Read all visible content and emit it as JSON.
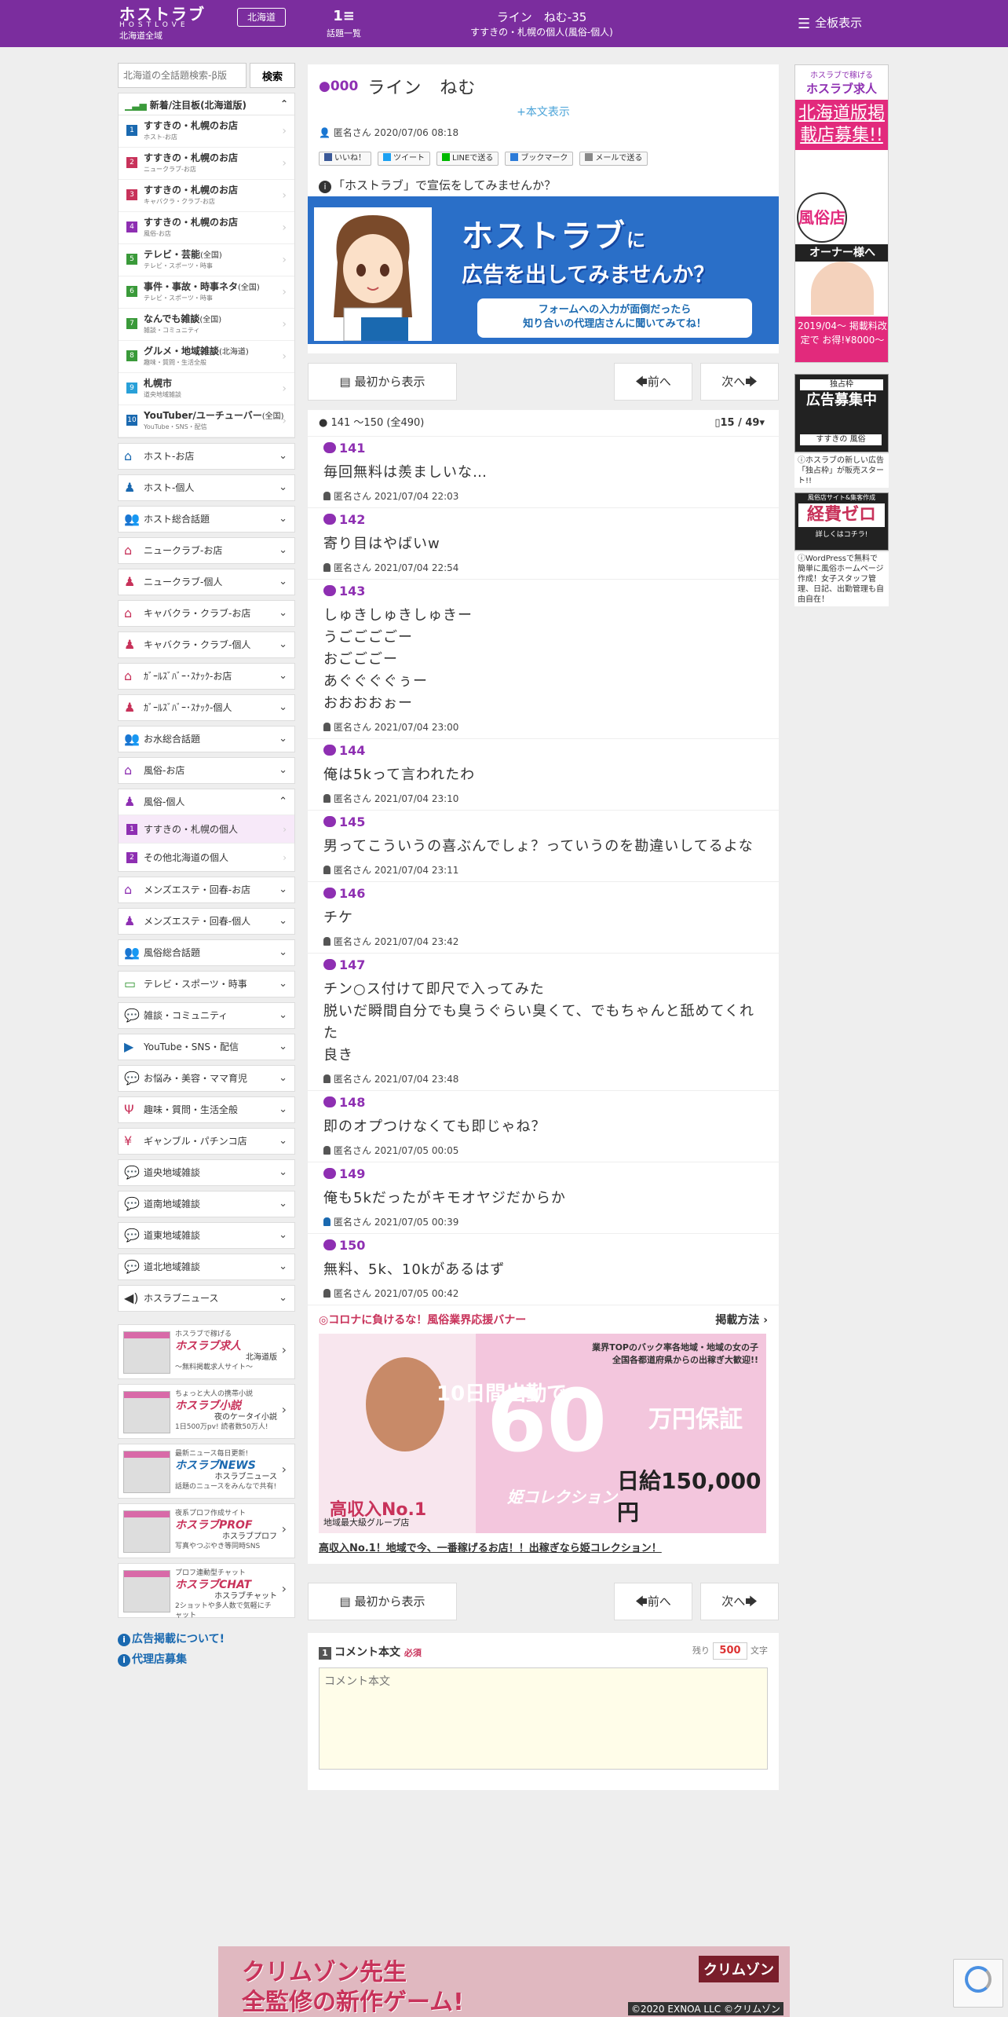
{
  "header": {
    "logo_main": "ホストラブ",
    "logo_sub": "HOSTLOVE",
    "logo_region": "北海道全域",
    "region_button": "北海道",
    "topics_label": "話題一覧",
    "title": "ライン　ねむ-35",
    "subtitle": "すすきの・札幌の個人(風俗-個人)",
    "show_all": "全板表示"
  },
  "sidebar": {
    "search_placeholder": "北海道の全話題検索-β版",
    "search_button": "検索",
    "new_header": "新着/注目板(北海道版)",
    "ranking": [
      {
        "n": "1",
        "label": "すすきの・札幌のお店",
        "pref": "",
        "sub": "ホスト-お店",
        "color": "#1a69b0"
      },
      {
        "n": "2",
        "label": "すすきの・札幌のお店",
        "pref": "",
        "sub": "ニュークラブ-お店",
        "color": "#c8325a"
      },
      {
        "n": "3",
        "label": "すすきの・札幌のお店",
        "pref": "",
        "sub": "キャバクラ・クラブ-お店",
        "color": "#c8325a"
      },
      {
        "n": "4",
        "label": "すすきの・札幌のお店",
        "pref": "",
        "sub": "風俗-お店",
        "color": "#8e2fb2"
      },
      {
        "n": "5",
        "label": "テレビ・芸能",
        "pref": "(全国)",
        "sub": "テレビ・スポーツ・時事",
        "color": "#3a9a3a"
      },
      {
        "n": "6",
        "label": "事件・事故・時事ネタ",
        "pref": "(全国)",
        "sub": "テレビ・スポーツ・時事",
        "color": "#3a9a3a"
      },
      {
        "n": "7",
        "label": "なんでも雑談",
        "pref": "(全国)",
        "sub": "雑談・コミュニティ",
        "color": "#3a9a3a"
      },
      {
        "n": "8",
        "label": "グルメ・地域雑談",
        "pref": "(北海道)",
        "sub": "趣味・質問・生活全般",
        "color": "#3a9a3a"
      },
      {
        "n": "9",
        "label": "札幌市",
        "pref": "",
        "sub": "道央地域雑談",
        "color": "#29a0d8"
      },
      {
        "n": "10",
        "label": "YouTuber/ユーチューバー",
        "pref": "(全国)",
        "sub": "YouTube・SNS・配信",
        "color": "#1a69b0"
      }
    ],
    "categories_top": [
      {
        "label": "ホスト-お店",
        "icon": "house-icon",
        "cls": ""
      },
      {
        "label": "ホスト-個人",
        "icon": "person-icon",
        "cls": ""
      },
      {
        "label": "ホスト総合話題",
        "icon": "group-icon",
        "cls": ""
      },
      {
        "label": "ニュークラブ-お店",
        "icon": "house-icon",
        "cls": "red"
      },
      {
        "label": "ニュークラブ-個人",
        "icon": "person-icon",
        "cls": "red"
      },
      {
        "label": "キャバクラ・クラブ-お店",
        "icon": "house-icon",
        "cls": "pink"
      },
      {
        "label": "キャバクラ・クラブ-個人",
        "icon": "person-icon",
        "cls": "pink"
      },
      {
        "label": "ｶﾞｰﾙｽﾞﾊﾞｰ･ｽﾅｯｸ-お店",
        "icon": "house-icon",
        "cls": "pink"
      },
      {
        "label": "ｶﾞｰﾙｽﾞﾊﾞｰ･ｽﾅｯｸ-個人",
        "icon": "person-icon",
        "cls": "pink"
      },
      {
        "label": "お水総合話題",
        "icon": "group-icon",
        "cls": "pink"
      },
      {
        "label": "風俗-お店",
        "icon": "house-icon",
        "cls": "pur"
      }
    ],
    "open_category": {
      "label": "風俗-個人",
      "items": [
        {
          "n": "1",
          "label": "すすきの・札幌の個人"
        },
        {
          "n": "2",
          "label": "その他北海道の個人"
        }
      ]
    },
    "categories_bottom": [
      {
        "label": "メンズエステ・回春-お店",
        "icon": "house-icon",
        "cls": "pur"
      },
      {
        "label": "メンズエステ・回春-個人",
        "icon": "person-icon",
        "cls": "pur"
      },
      {
        "label": "風俗総合話題",
        "icon": "group-icon",
        "cls": "pur"
      },
      {
        "label": "テレビ・スポーツ・時事",
        "icon": "tv-icon",
        "cls": "grn"
      },
      {
        "label": "雑談・コミュニティ",
        "icon": "chat-icon",
        "cls": "grn"
      },
      {
        "label": "YouTube・SNS・配信",
        "icon": "youtube-icon",
        "cls": ""
      },
      {
        "label": "お悩み・美容・ママ育児",
        "icon": "chat-icon",
        "cls": ""
      },
      {
        "label": "趣味・質問・生活全般",
        "icon": "fork-icon",
        "cls": "red"
      },
      {
        "label": "ギャンブル・パチンコ店",
        "icon": "money-icon",
        "cls": "red"
      },
      {
        "label": "道央地域雑談",
        "icon": "chat-icon",
        "cls": ""
      },
      {
        "label": "道南地域雑談",
        "icon": "chat-icon",
        "cls": ""
      },
      {
        "label": "道東地域雑談",
        "icon": "chat-icon",
        "cls": ""
      },
      {
        "label": "道北地域雑談",
        "icon": "chat-icon",
        "cls": ""
      },
      {
        "label": "ホスラブニュース",
        "icon": "speaker-icon",
        "cls": "dk"
      }
    ],
    "services": [
      {
        "brand": "ホスラブ求人",
        "top": "ホスラブで稼げる",
        "name": "北海道版",
        "desc": "〜無料掲載求人サイト〜",
        "blue": false
      },
      {
        "brand": "ホスラブ小説",
        "top": "ちょっと大人の携帯小説",
        "name": "夜のケータイ小説",
        "desc": "1日500万pv! 読者数50万人!",
        "blue": false
      },
      {
        "brand": "ホスラブNEWS",
        "top": "最新ニュース毎日更新!",
        "name": "ホスラブニュース",
        "desc": "話題のニュースをみんなで共有!",
        "blue": true
      },
      {
        "brand": "ホスラブPROF",
        "top": "夜系プロフ作成サイト",
        "name": "ホスラブプロフ",
        "desc": "写真やつぶやき等同時SNS",
        "blue": false
      },
      {
        "brand": "ホスラブCHAT",
        "top": "プロフ連動型チャット",
        "name": "ホスラブチャット",
        "desc": "2ショットや多人数で気軽にチャット",
        "blue": false
      }
    ],
    "link_ads": "広告掲載について!",
    "link_agency": "代理店募集"
  },
  "thread": {
    "number": "000",
    "title": "ライン　ねむ",
    "body_toggle": "+本文表示",
    "author": "匿名さん",
    "date": "2020/07/06 08:18",
    "shares": [
      "いいね！",
      "ツイート",
      "LINEで送る",
      "ブックマーク",
      "メールで送る"
    ]
  },
  "ad": {
    "caption": "「ホストラブ」で宣伝をしてみませんか？",
    "headline1": "ホストラブ",
    "headline1_suffix": "に",
    "headline2": "広告を出してみませんか？",
    "box_line1": "フォームへの入力が面倒だったら",
    "box_line2": "知り合いの代理店さんに聞いてみてね！"
  },
  "nav": {
    "first": "最初から表示",
    "prev": "前へ",
    "next": "次へ"
  },
  "list": {
    "range": "141 ～150",
    "total": "(全490)",
    "page": "15 / 49"
  },
  "posts": [
    {
      "no": "141",
      "body": [
        "毎回無料は羨ましいな…"
      ],
      "author": "匿名さん",
      "date": "2021/07/04 22:03",
      "male": false
    },
    {
      "no": "142",
      "body": [
        "寄り目はやばいw"
      ],
      "author": "匿名さん",
      "date": "2021/07/04 22:54",
      "male": false
    },
    {
      "no": "143",
      "body": [
        "しゅきしゅきしゅきー",
        "うごごごごー",
        "おごごごー",
        "あぐぐぐぐぅー",
        "おおおおぉー"
      ],
      "author": "匿名さん",
      "date": "2021/07/04 23:00",
      "male": false
    },
    {
      "no": "144",
      "body": [
        "俺は5kって言われたわ"
      ],
      "author": "匿名さん",
      "date": "2021/07/04 23:10",
      "male": false
    },
    {
      "no": "145",
      "body": [
        "男ってこういうの喜ぶんでしょ？っていうのを勘違いしてるよな"
      ],
      "author": "匿名さん",
      "date": "2021/07/04 23:11",
      "male": false
    },
    {
      "no": "146",
      "body": [
        "チケ"
      ],
      "author": "匿名さん",
      "date": "2021/07/04 23:42",
      "male": false
    },
    {
      "no": "147",
      "body": [
        "チン○ス付けて即尺で入ってみた",
        "脱いだ瞬間自分でも臭うぐらい臭くて、でもちゃんと舐めてくれた",
        "良き"
      ],
      "author": "匿名さん",
      "date": "2021/07/04 23:48",
      "male": false
    },
    {
      "no": "148",
      "body": [
        "即のオプつけなくても即じゃね？"
      ],
      "author": "匿名さん",
      "date": "2021/07/05 00:05",
      "male": false
    },
    {
      "no": "149",
      "body": [
        "俺も5kだったがキモオヤジだからか"
      ],
      "author": "匿名さん",
      "date": "2021/07/05 00:39",
      "male": true
    },
    {
      "no": "150",
      "body": [
        "無料、5k、10kがあるはず"
      ],
      "author": "匿名さん",
      "date": "2021/07/05 00:42",
      "male": false
    }
  ],
  "banner": {
    "header": "◎コロナに負けるな！風俗業界応援バナー",
    "method": "掲載方法",
    "copy1": "業界TOPのバック率各地域・地域の女の子",
    "copy2": "全国各都道府県からの出稼ぎ大歓迎!!",
    "days": "10日間出勤で",
    "big": "60",
    "guarantee": "万円保証",
    "daily": "日給150,000円",
    "brand": "姫コレクション",
    "income": "高収入No.1",
    "group": "地域最大級グループ店",
    "link": "高収入No.1！地域で今、一番稼げるお店！！出稼ぎなら姫コレクション！"
  },
  "comment": {
    "label": "コメント本文",
    "required": "必須",
    "remain_label": "残り",
    "remain": "500",
    "unit": "文字",
    "placeholder": "コメント本文"
  },
  "right": {
    "r1_top": "ホスラブで稼げる",
    "r1_logo": "ホスラブ求人",
    "r1_pink": "北海道版掲載店募集!!",
    "r1_bubble": "風俗店",
    "r1_owner": "オーナー様へ",
    "r1_bottom": "2019/04〜 掲載料改定で お得!¥8000〜",
    "r2_a": "独占枠",
    "r2_b": "広告募集中",
    "r2_c": "すすきの 風俗",
    "r2_cap": "ホスラブの新しい広告「独占枠」が販売スタート!!",
    "r3_a": "風俗店サイト&集客作成",
    "r3_b": "経費ゼロ",
    "r3_c": "詳しくはコチラ!",
    "r3_cap": "WordPressで無料で簡単に風俗ホームページ作成！女子スタッフ管理、日記、出勤管理も自由自在！"
  },
  "footer_ad": {
    "line1": "クリムゾン先生",
    "line2": "全監修の新作ゲーム!",
    "logo": "クリムゾン",
    "copyright": "©2020 EXNOA LLC ©クリムゾン"
  }
}
